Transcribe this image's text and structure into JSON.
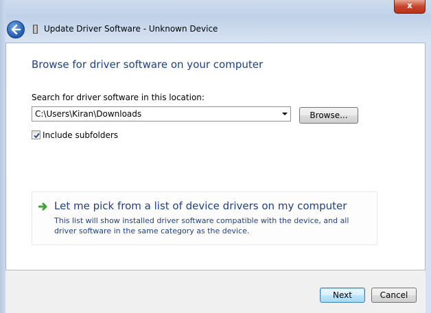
{
  "window": {
    "title": "Update Driver Software - Unknown Device",
    "close_label": "x"
  },
  "main": {
    "heading": "Browse for driver software on your computer",
    "search_label": "Search for driver software in this location:",
    "path_value": "C:\\Users\\Kiran\\Downloads",
    "browse_label": "Browse...",
    "include_subfolders_label": "Include subfolders",
    "include_subfolders_checked": true
  },
  "pick": {
    "title": "Let me pick from a list of device drivers on my computer",
    "description": "This list will show installed driver software compatible with the device, and all driver software in the same category as the device."
  },
  "footer": {
    "next_label": "Next",
    "cancel_label": "Cancel"
  },
  "colors": {
    "heading": "#1e3f8a",
    "arrow_green": "#3fa535"
  }
}
